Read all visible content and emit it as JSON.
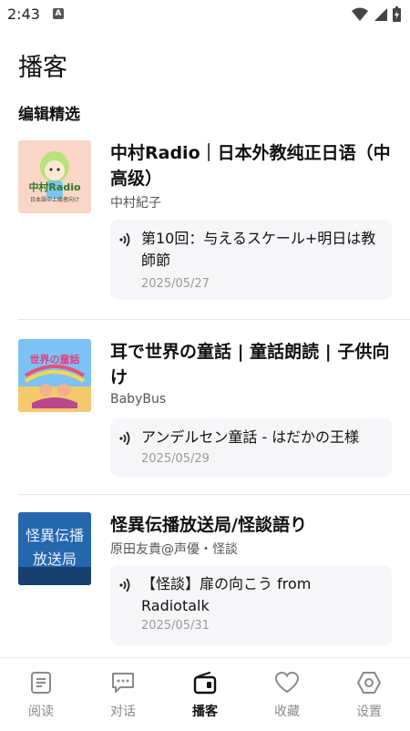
{
  "status": {
    "time": "2:43",
    "app_indicator": "A"
  },
  "header": {
    "title": "播客"
  },
  "section": {
    "title": "编辑精选"
  },
  "podcasts": [
    {
      "title": "中村Radio｜日本外教纯正日语（中高级）",
      "author": "中村紀子",
      "cover_text": "中村Radio",
      "cover_sub": "日本語中上級者向け",
      "episode": {
        "title": "第10回：与えるスケール+明日は教師節",
        "date": "2025/05/27"
      }
    },
    {
      "title": "耳で世界の童話 | 童話朗読 | 子供向け",
      "author": "BabyBus",
      "cover_text": "世界の童話",
      "episode": {
        "title": "アンデルセン童話 - はだかの王様",
        "date": "2025/05/29"
      }
    },
    {
      "title": "怪異伝播放送局/怪談語り",
      "author": "原田友貴@声優・怪談",
      "cover_text_line1": "怪異伝播",
      "cover_text_line2": "放送局",
      "episode": {
        "title": "【怪談】扉の向こう from Radiotalk",
        "date": "2025/05/31"
      }
    }
  ],
  "tabs": [
    {
      "label": "阅读",
      "icon": "document-icon"
    },
    {
      "label": "对话",
      "icon": "chat-bubble-icon"
    },
    {
      "label": "播客",
      "icon": "radio-icon",
      "active": true
    },
    {
      "label": "收藏",
      "icon": "heart-icon"
    },
    {
      "label": "设置",
      "icon": "settings-hexagon-icon"
    }
  ],
  "colors": {
    "active_tab": "#111111",
    "inactive_tab": "#8a8a8a",
    "episode_bg": "#f6f6f8"
  }
}
